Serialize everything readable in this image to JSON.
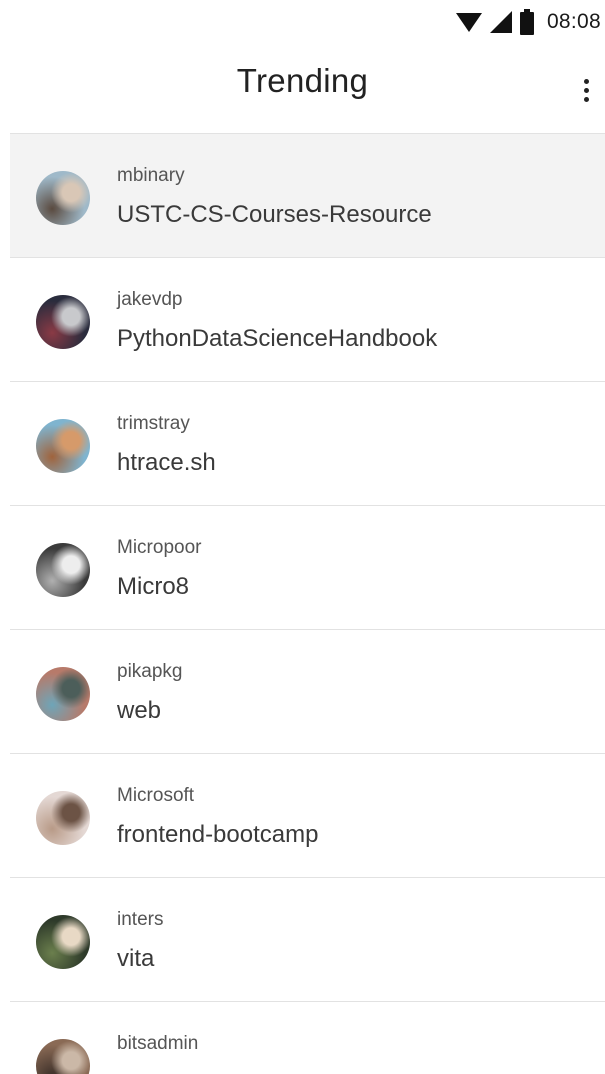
{
  "status_bar": {
    "time": "08:08",
    "icons": [
      "wifi-icon",
      "cell-signal-icon",
      "battery-icon"
    ]
  },
  "app_bar": {
    "title": "Trending",
    "menu_icon": "more-vert-icon"
  },
  "repos": [
    {
      "owner": "mbinary",
      "name": "USTC-CS-Courses-Resource",
      "selected": true,
      "avatar_colors": [
        "#9fb9c9",
        "#5a4a3f",
        "#d9c7b6"
      ]
    },
    {
      "owner": "jakevdp",
      "name": "PythonDataScienceHandbook",
      "selected": false,
      "avatar_colors": [
        "#2a2c3d",
        "#8a3a45",
        "#c8c9cc"
      ]
    },
    {
      "owner": "trimstray",
      "name": "htrace.sh",
      "selected": false,
      "avatar_colors": [
        "#7fb4cf",
        "#a0633c",
        "#d69a6a"
      ]
    },
    {
      "owner": "Micropoor",
      "name": "Micro8",
      "selected": false,
      "avatar_colors": [
        "#3b3b3b",
        "#b0b0b0",
        "#ededed"
      ]
    },
    {
      "owner": "pikapkg",
      "name": "web",
      "selected": false,
      "avatar_colors": [
        "#b77a6a",
        "#6ea5b8",
        "#4c5e5a"
      ]
    },
    {
      "owner": "Microsoft",
      "name": "frontend-bootcamp",
      "selected": false,
      "avatar_colors": [
        "#e4d8d4",
        "#b89a87",
        "#6c5345"
      ]
    },
    {
      "owner": "inters",
      "name": "vita",
      "selected": false,
      "avatar_colors": [
        "#2e3a2a",
        "#6b7f4d",
        "#e8d9c5"
      ]
    },
    {
      "owner": "bitsadmin",
      "name": "",
      "selected": false,
      "avatar_colors": [
        "#8a6a55",
        "#3a2e28",
        "#cbb8a7"
      ]
    }
  ]
}
